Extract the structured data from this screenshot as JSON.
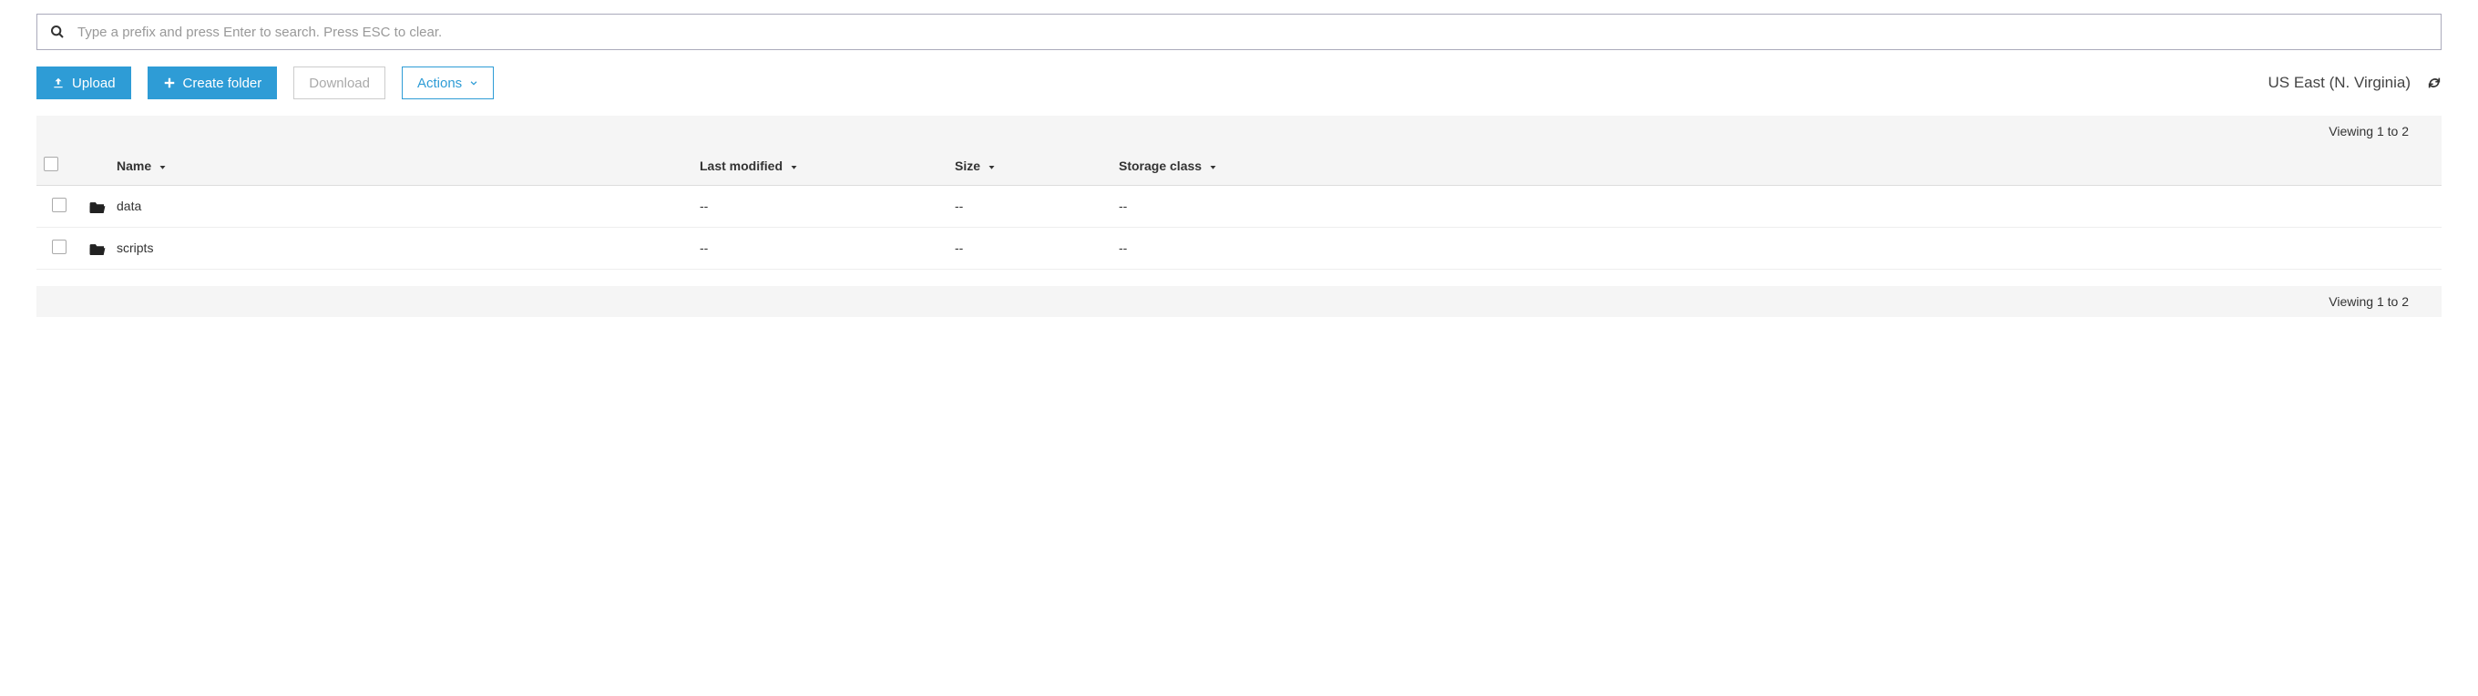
{
  "search": {
    "placeholder": "Type a prefix and press Enter to search. Press ESC to clear."
  },
  "toolbar": {
    "upload_label": "Upload",
    "create_folder_label": "Create folder",
    "download_label": "Download",
    "actions_label": "Actions"
  },
  "region_label": "US East (N. Virginia)",
  "pager_text": "Viewing 1 to 2",
  "columns": {
    "name": "Name",
    "last_modified": "Last modified",
    "size": "Size",
    "storage_class": "Storage class"
  },
  "rows": [
    {
      "name": "data",
      "last_modified": "--",
      "size": "--",
      "storage_class": "--"
    },
    {
      "name": "scripts",
      "last_modified": "--",
      "size": "--",
      "storage_class": "--"
    }
  ]
}
